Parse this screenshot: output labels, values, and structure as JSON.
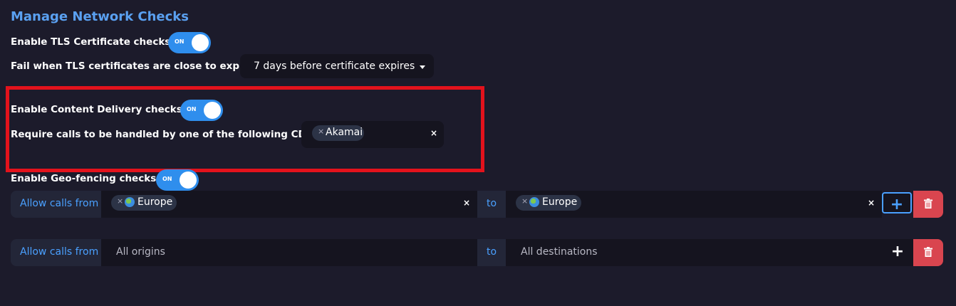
{
  "page": {
    "title": "Manage Network Checks"
  },
  "tls": {
    "enable_label": "Enable TLS Certificate checks:",
    "toggle_text": "ON",
    "expiry_label": "Fail when TLS certificates are close to expiry:",
    "expiry_value": "7 days before certificate expires"
  },
  "cdn": {
    "enable_label": "Enable Content Delivery checks:",
    "toggle_text": "ON",
    "require_label": "Require calls to be handled by one of the following CDNs:",
    "chips": [
      "Akamai"
    ],
    "remove_symbol": "×",
    "clear_symbol": "×"
  },
  "geo": {
    "enable_label": "Enable Geo-fencing checks:",
    "toggle_text": "ON",
    "rows": [
      {
        "allow_label": "Allow calls from",
        "from_chip": "Europe",
        "to_label": "to",
        "to_chip": "Europe",
        "add_symbol": "+",
        "clear_symbol": "×"
      },
      {
        "allow_label": "Allow calls from",
        "from_placeholder": "All origins",
        "to_label": "to",
        "to_placeholder": "All destinations",
        "add_symbol": "+"
      }
    ]
  },
  "colors": {
    "accent": "#2f8eed",
    "title": "#5aa0f0",
    "highlight_border": "#e3121c",
    "delete": "#d9454f",
    "background": "#1c1b2b"
  },
  "icons": [
    "globe-icon",
    "trash-icon",
    "plus-icon",
    "close-icon",
    "caret-down-icon"
  ]
}
